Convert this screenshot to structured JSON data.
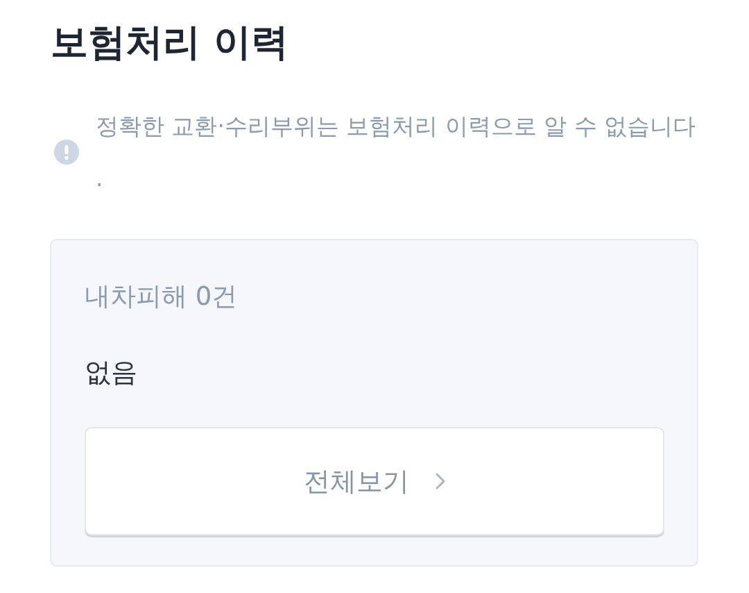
{
  "title": "보험처리 이력",
  "notice": {
    "text": "정확한 교환·수리부위는 보험처리 이력으로 알 수 없습니다."
  },
  "card": {
    "summary": "내차피해 0건",
    "detail": "없음",
    "button": {
      "label": "전체보기"
    }
  }
}
